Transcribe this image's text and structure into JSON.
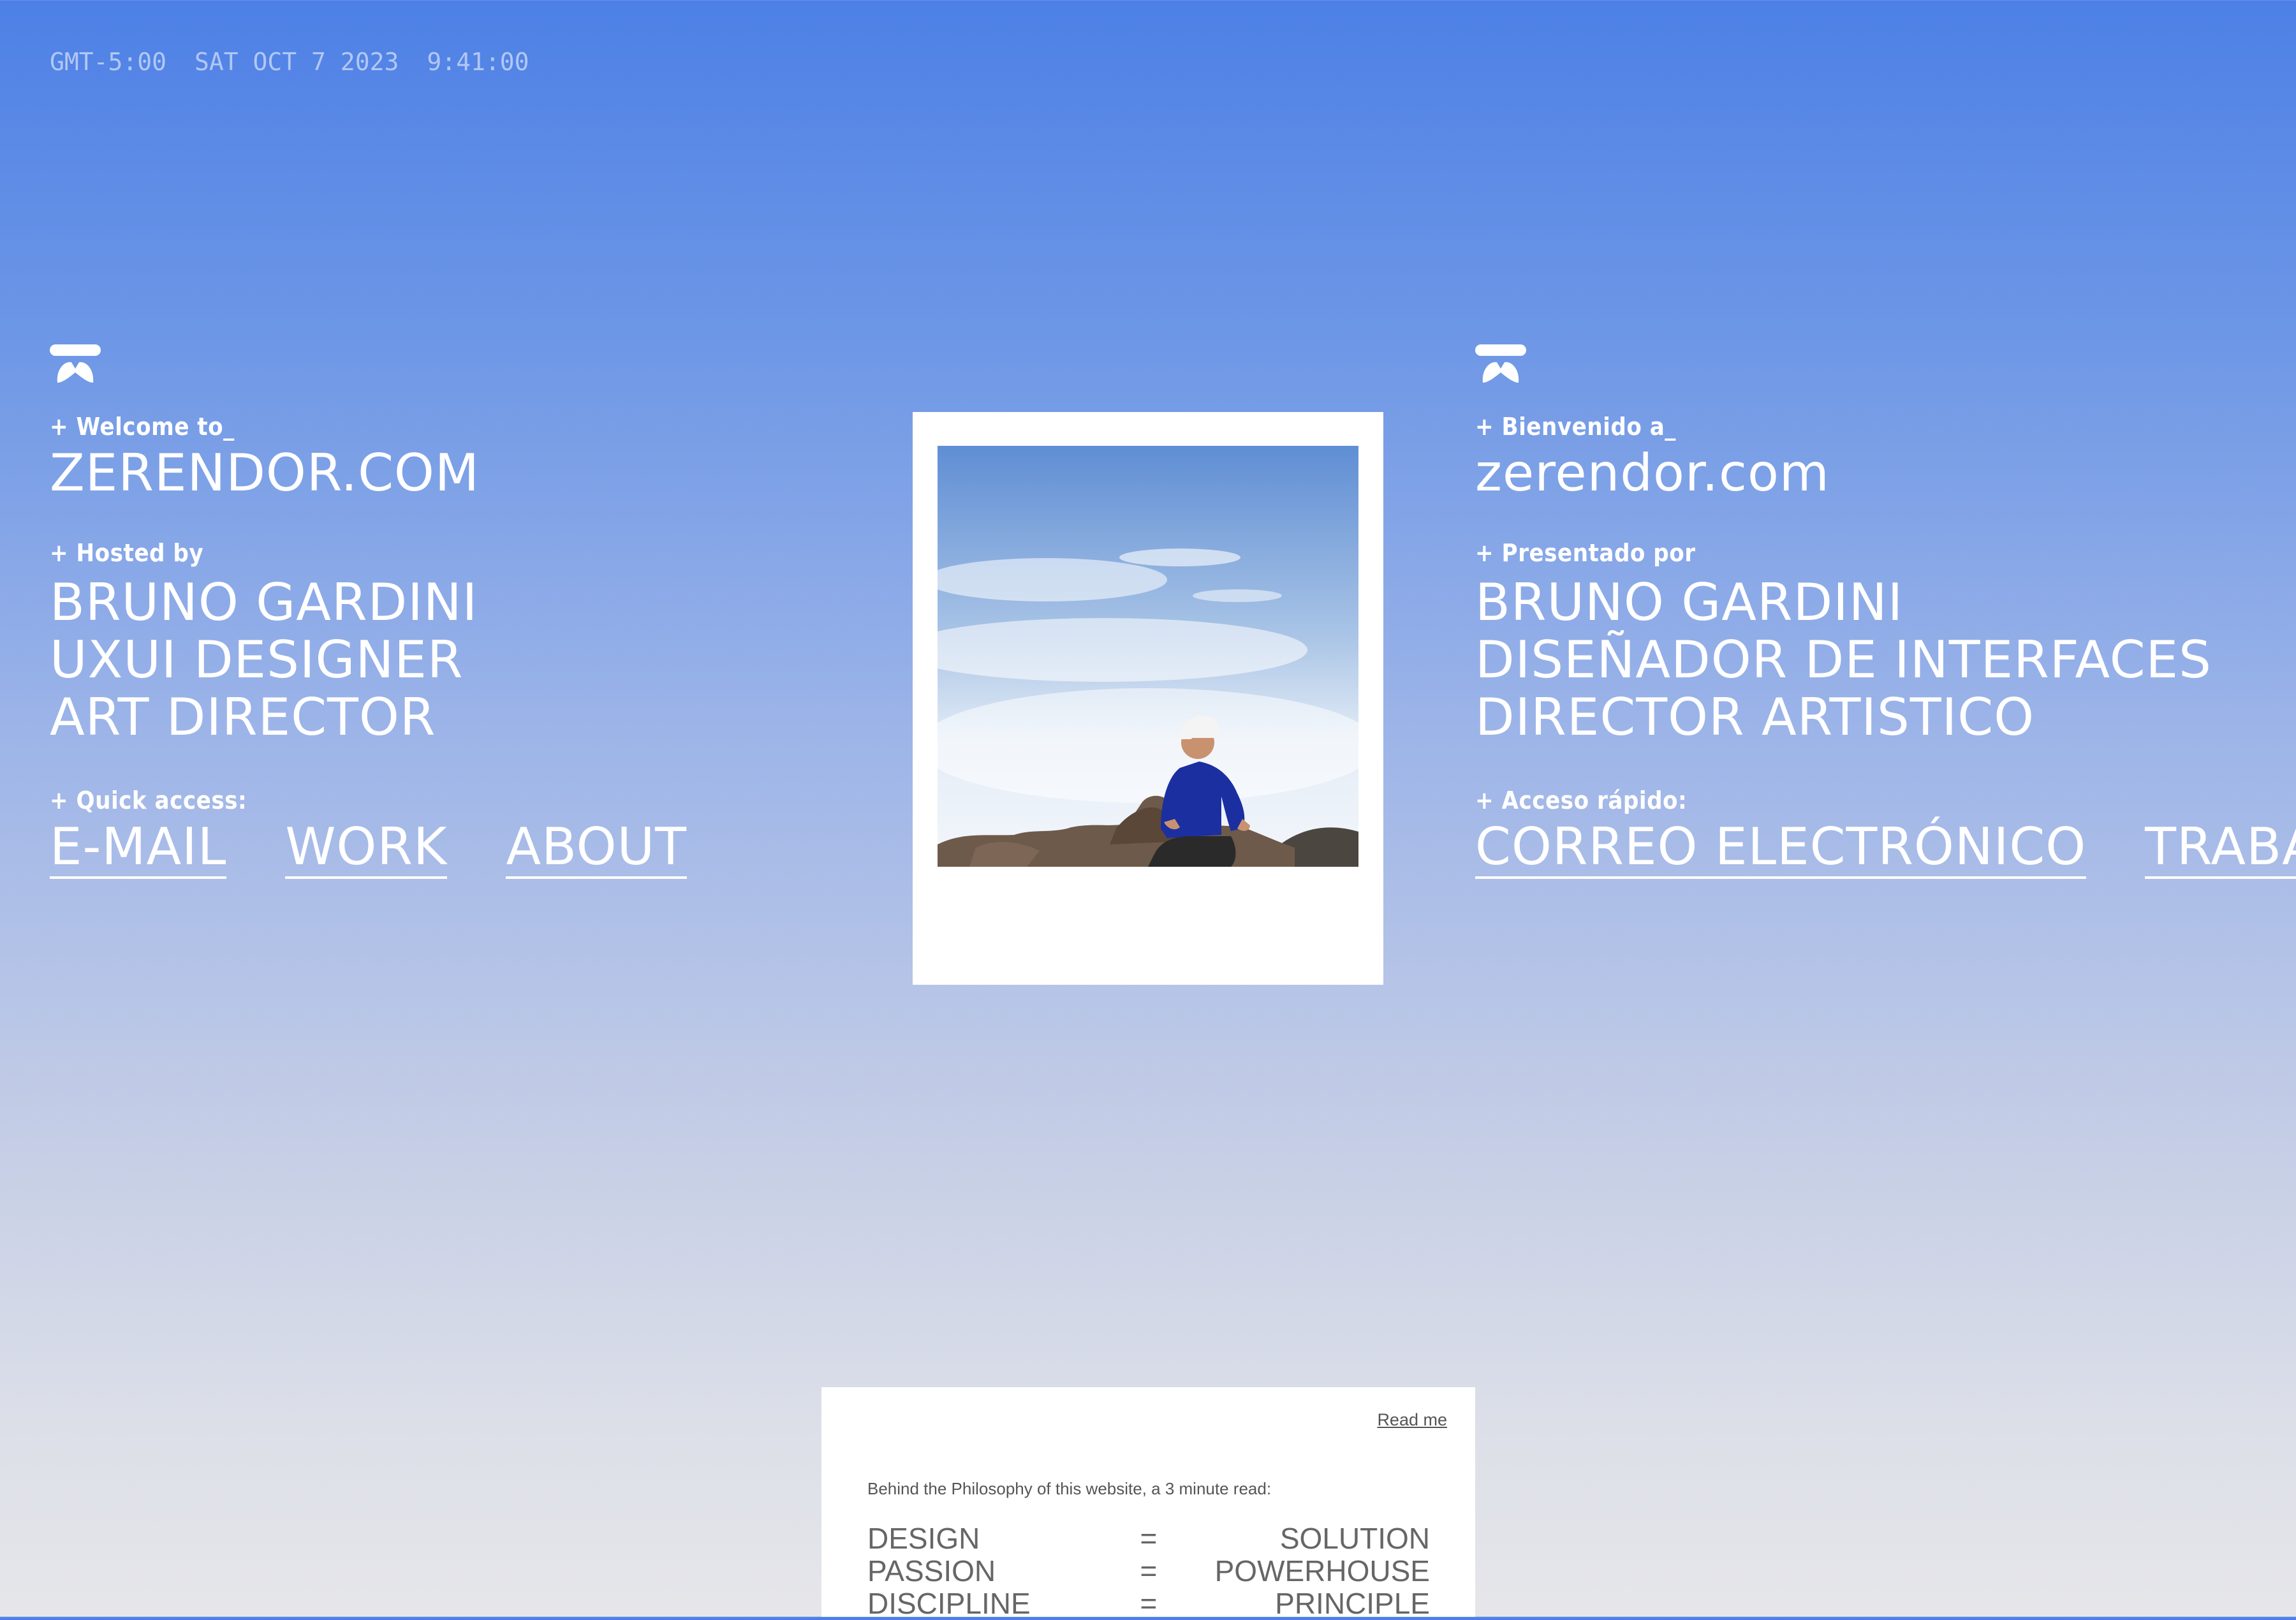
{
  "header": {
    "timezone": "GMT-5:00",
    "date": "SAT OCT 7 2023",
    "time": "9:41:00"
  },
  "left_column": {
    "logo_icon": "zerendor-logo-icon",
    "welcome_label": "+ Welcome to_",
    "site_name": "ZERENDOR.COM",
    "hosted_label": "+ Hosted by",
    "hosted_lines": [
      "BRUNO GARDINI",
      "UXUI DESIGNER",
      "ART DIRECTOR"
    ],
    "quick_access_label": "+ Quick access:",
    "links": [
      "E-MAIL",
      "WORK",
      "ABOUT"
    ]
  },
  "right_column": {
    "logo_icon": "zerendor-logo-icon",
    "welcome_label": "+ Bienvenido a_",
    "site_name": "zerendor.com",
    "hosted_label": "+ Presentado por",
    "hosted_lines": [
      "BRUNO GARDINI",
      "DISEÑADOR DE INTERFACES",
      "DIRECTOR ARTISTICO"
    ],
    "quick_access_label": "+ Acceso rápido:",
    "links": [
      "CORREO ELECTRÓNICO",
      "TRABAJO"
    ]
  },
  "photo": {
    "subject": "man in white cap and blue sweater sitting on rocks above clouds"
  },
  "card": {
    "read_me_link": "Read me",
    "intro": "Behind the Philosophy of this website, a 3 minute read:",
    "rows": [
      {
        "key": "DESIGN",
        "op": "=",
        "value": "SOLUTION"
      },
      {
        "key": "PASSION",
        "op": "=",
        "value": "POWERHOUSE"
      },
      {
        "key": "DISCIPLINE",
        "op": "=",
        "value": "PRINCIPLE"
      }
    ]
  },
  "colors": {
    "sky_top": "#4d80e6",
    "sky_bottom": "#e6e6ea",
    "text": "#ffffff",
    "card_text": "#555555"
  }
}
